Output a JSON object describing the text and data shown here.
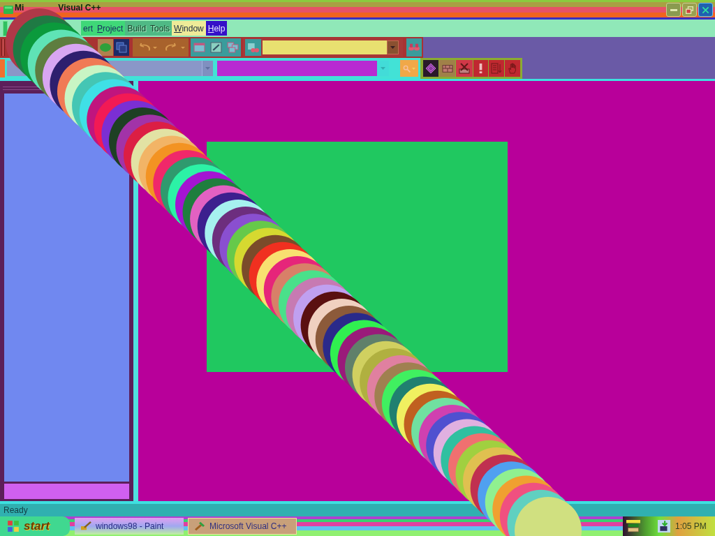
{
  "window": {
    "title_start": "Mi",
    "title_end": "Visual C++"
  },
  "menu": [
    {
      "label": "ert",
      "underline_first": false,
      "disabled": false
    },
    {
      "label": "Project",
      "underline_first": true,
      "disabled": false
    },
    {
      "label": "Build",
      "underline_first": false,
      "disabled": true
    },
    {
      "label": "Tools",
      "underline_first": false,
      "disabled": true
    },
    {
      "label": "Window",
      "underline_first": true,
      "disabled": false
    },
    {
      "label": "Help",
      "underline_first": true,
      "disabled": false
    }
  ],
  "status_bar": {
    "text": "Ready"
  },
  "taskbar": {
    "start": "start",
    "buttons": [
      {
        "label": "windows98 - Paint",
        "selected": false
      },
      {
        "label": "Microsoft Visual C++",
        "selected": true
      }
    ],
    "clock": "1:05 PM"
  }
}
